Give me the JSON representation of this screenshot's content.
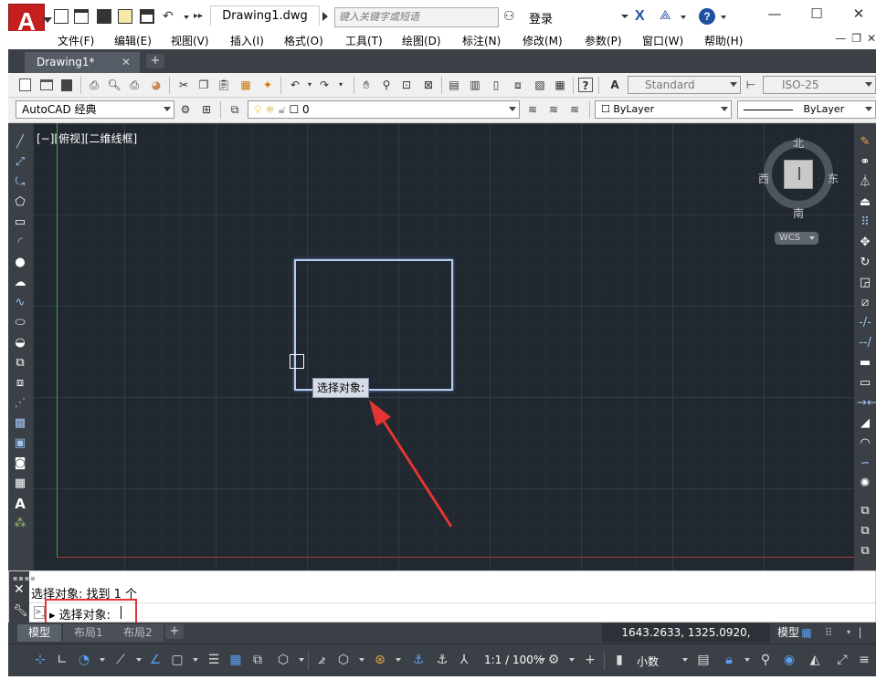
{
  "window": {
    "doc_title": "Drawing1.dwg",
    "search_placeholder": "键入关键字或短语",
    "login_label": "登录",
    "minimize": "—",
    "maximize": "☐",
    "close": "✕"
  },
  "menu": [
    "文件(F)",
    "编辑(E)",
    "视图(V)",
    "插入(I)",
    "格式(O)",
    "工具(T)",
    "绘图(D)",
    "标注(N)",
    "修改(M)",
    "参数(P)",
    "窗口(W)",
    "帮助(H)"
  ],
  "file_tab": {
    "label": "Drawing1*",
    "close": "✕",
    "new": "+"
  },
  "toolbar": {
    "text_style": "Standard",
    "dim_style": "ISO-25",
    "workspace": "AutoCAD 经典",
    "layer": "0",
    "color": "ByLayer",
    "linetype": "ByLayer"
  },
  "canvas": {
    "view_label": "[−][俯视][二维线框]",
    "tooltip": "选择对象:",
    "compass": {
      "north": "北",
      "south": "南",
      "east": "东",
      "west": "西"
    },
    "wcs": "WCS"
  },
  "command": {
    "history": "选择对象: 找到 1 个",
    "prompt": "选择对象:"
  },
  "layout_tabs": [
    "模型",
    "布局1",
    "布局2"
  ],
  "status": {
    "coordinates": "1643.2633, 1325.0920, 0.0000",
    "model": "模型",
    "scale": "1:1 / 100%",
    "units": "小数"
  },
  "colors": {
    "canvas": "#212830",
    "accent_red": "#e53434",
    "selection": "#b8ccec"
  }
}
